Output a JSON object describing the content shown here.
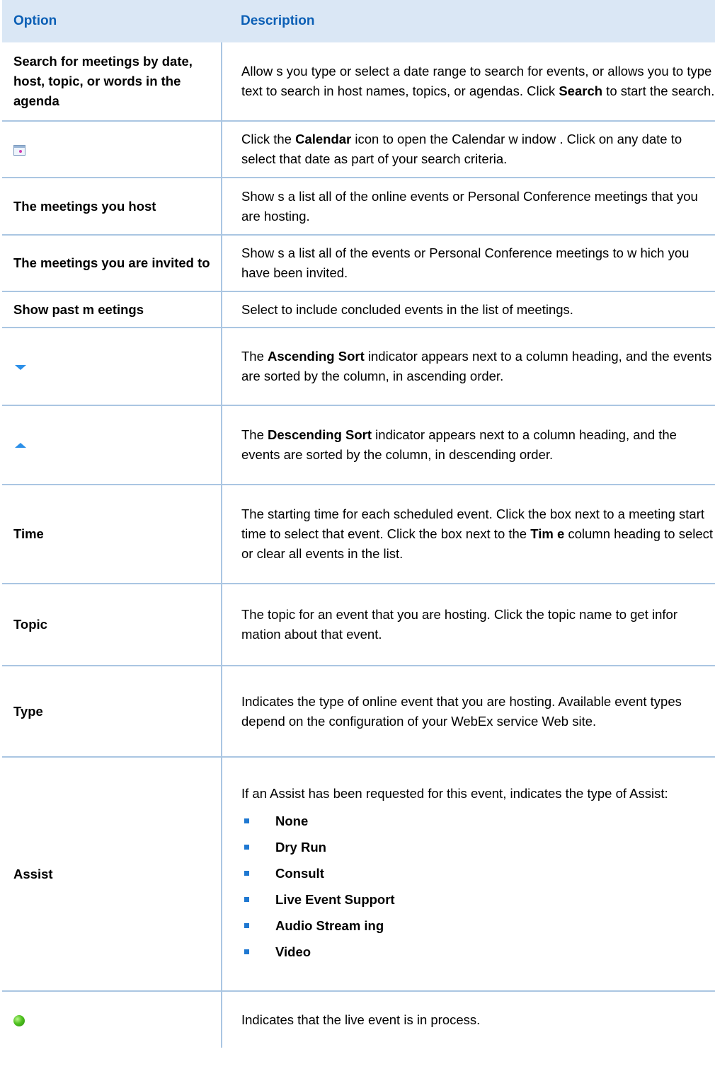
{
  "header": {
    "option": "Option",
    "description": "Description"
  },
  "rows": {
    "search": {
      "option": "Search for meetings by date, host, topic, or words in the agenda",
      "desc_1": "Allow s you type or select a date range to search for events, or allows you to type text to search in host names, topics, or agendas. Click ",
      "desc_bold": "Search",
      "desc_2": " to start the search."
    },
    "calendar": {
      "icon": "calendar-icon",
      "desc_1": "Click the ",
      "desc_bold": "Calendar",
      "desc_2": " icon to open the Calendar w indow . Click on any date to select that date as part of your search criteria."
    },
    "host": {
      "option": "The meetings you host",
      "desc": "Show s a list all of the online events or Personal Conference meetings that you are hosting."
    },
    "invited": {
      "option": "The meetings you are invited to",
      "desc": "Show s a list all of the events or Personal Conference meetings to w hich you have been invited."
    },
    "past": {
      "option": "Show past m eetings",
      "desc": "Select to include concluded events in the list of meetings."
    },
    "ascending": {
      "icon": "ascending-sort-icon",
      "desc_1": "The ",
      "desc_bold": "Ascending Sort",
      "desc_2": " indicator appears next to a column heading, and the events are sorted by the column, in ascending order."
    },
    "descending": {
      "icon": "descending-sort-icon",
      "desc_1": "The ",
      "desc_bold": "Descending Sort",
      "desc_2": " indicator appears next to a column heading, and the events are sorted by the column, in descending order."
    },
    "time": {
      "option": "Time",
      "desc_1": "The starting time for each scheduled event. Click the box next to a meeting start time to select that event. Click the box next to the ",
      "desc_bold": "Tim e",
      "desc_2": " column heading to select or clear all events in the list."
    },
    "topic": {
      "option": "Topic",
      "desc": "The topic for an event that you are hosting. Click the topic name to get infor mation about that event."
    },
    "type": {
      "option": "Type",
      "desc": "Indicates the type of online event that you are hosting. Available event types depend on the configuration of your WebEx service Web site."
    },
    "assist": {
      "option": "Assist",
      "desc": "If an Assist has been requested for this event, indicates the type of Assist:",
      "items": [
        "None",
        "Dry Run",
        "Consult",
        "Live Event Support",
        "Audio Stream ing",
        "Video"
      ]
    },
    "live": {
      "icon": "live-event-icon",
      "desc": "Indicates that the live event is in process."
    }
  },
  "colors": {
    "header_bg": "#dae7f5",
    "header_text": "#0b5fb5",
    "rule": "#aac6e2",
    "bullet": "#1f78d1"
  }
}
